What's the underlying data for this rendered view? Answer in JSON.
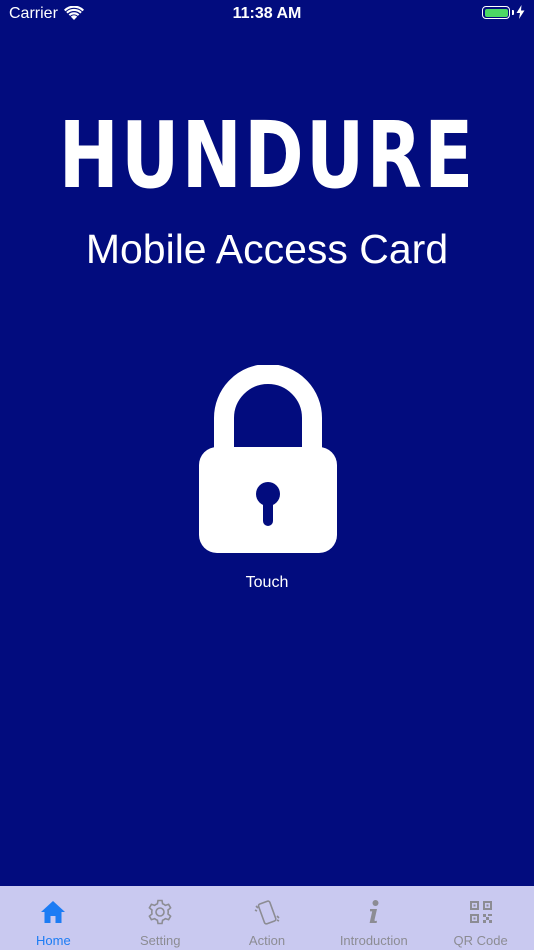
{
  "status_bar": {
    "carrier": "Carrier",
    "time": "11:38 AM",
    "battery_level": 1.0
  },
  "header": {
    "logo": "HUNDURE",
    "subtitle": "Mobile Access Card"
  },
  "lock": {
    "icon": "padlock-icon",
    "label": "Touch"
  },
  "tabs": [
    {
      "label": "Home",
      "icon": "home-icon",
      "active": true
    },
    {
      "label": "Setting",
      "icon": "gear-icon",
      "active": false
    },
    {
      "label": "Action",
      "icon": "phone-shake-icon",
      "active": false
    },
    {
      "label": "Introduction",
      "icon": "info-icon",
      "active": false
    },
    {
      "label": "QR Code",
      "icon": "qr-code-icon",
      "active": false
    }
  ],
  "colors": {
    "background": "#020c7e",
    "tab_bar": "#c9c9f0",
    "tab_active": "#1c7cf4",
    "tab_inactive": "#8c8c93",
    "battery": "#4cd964"
  }
}
